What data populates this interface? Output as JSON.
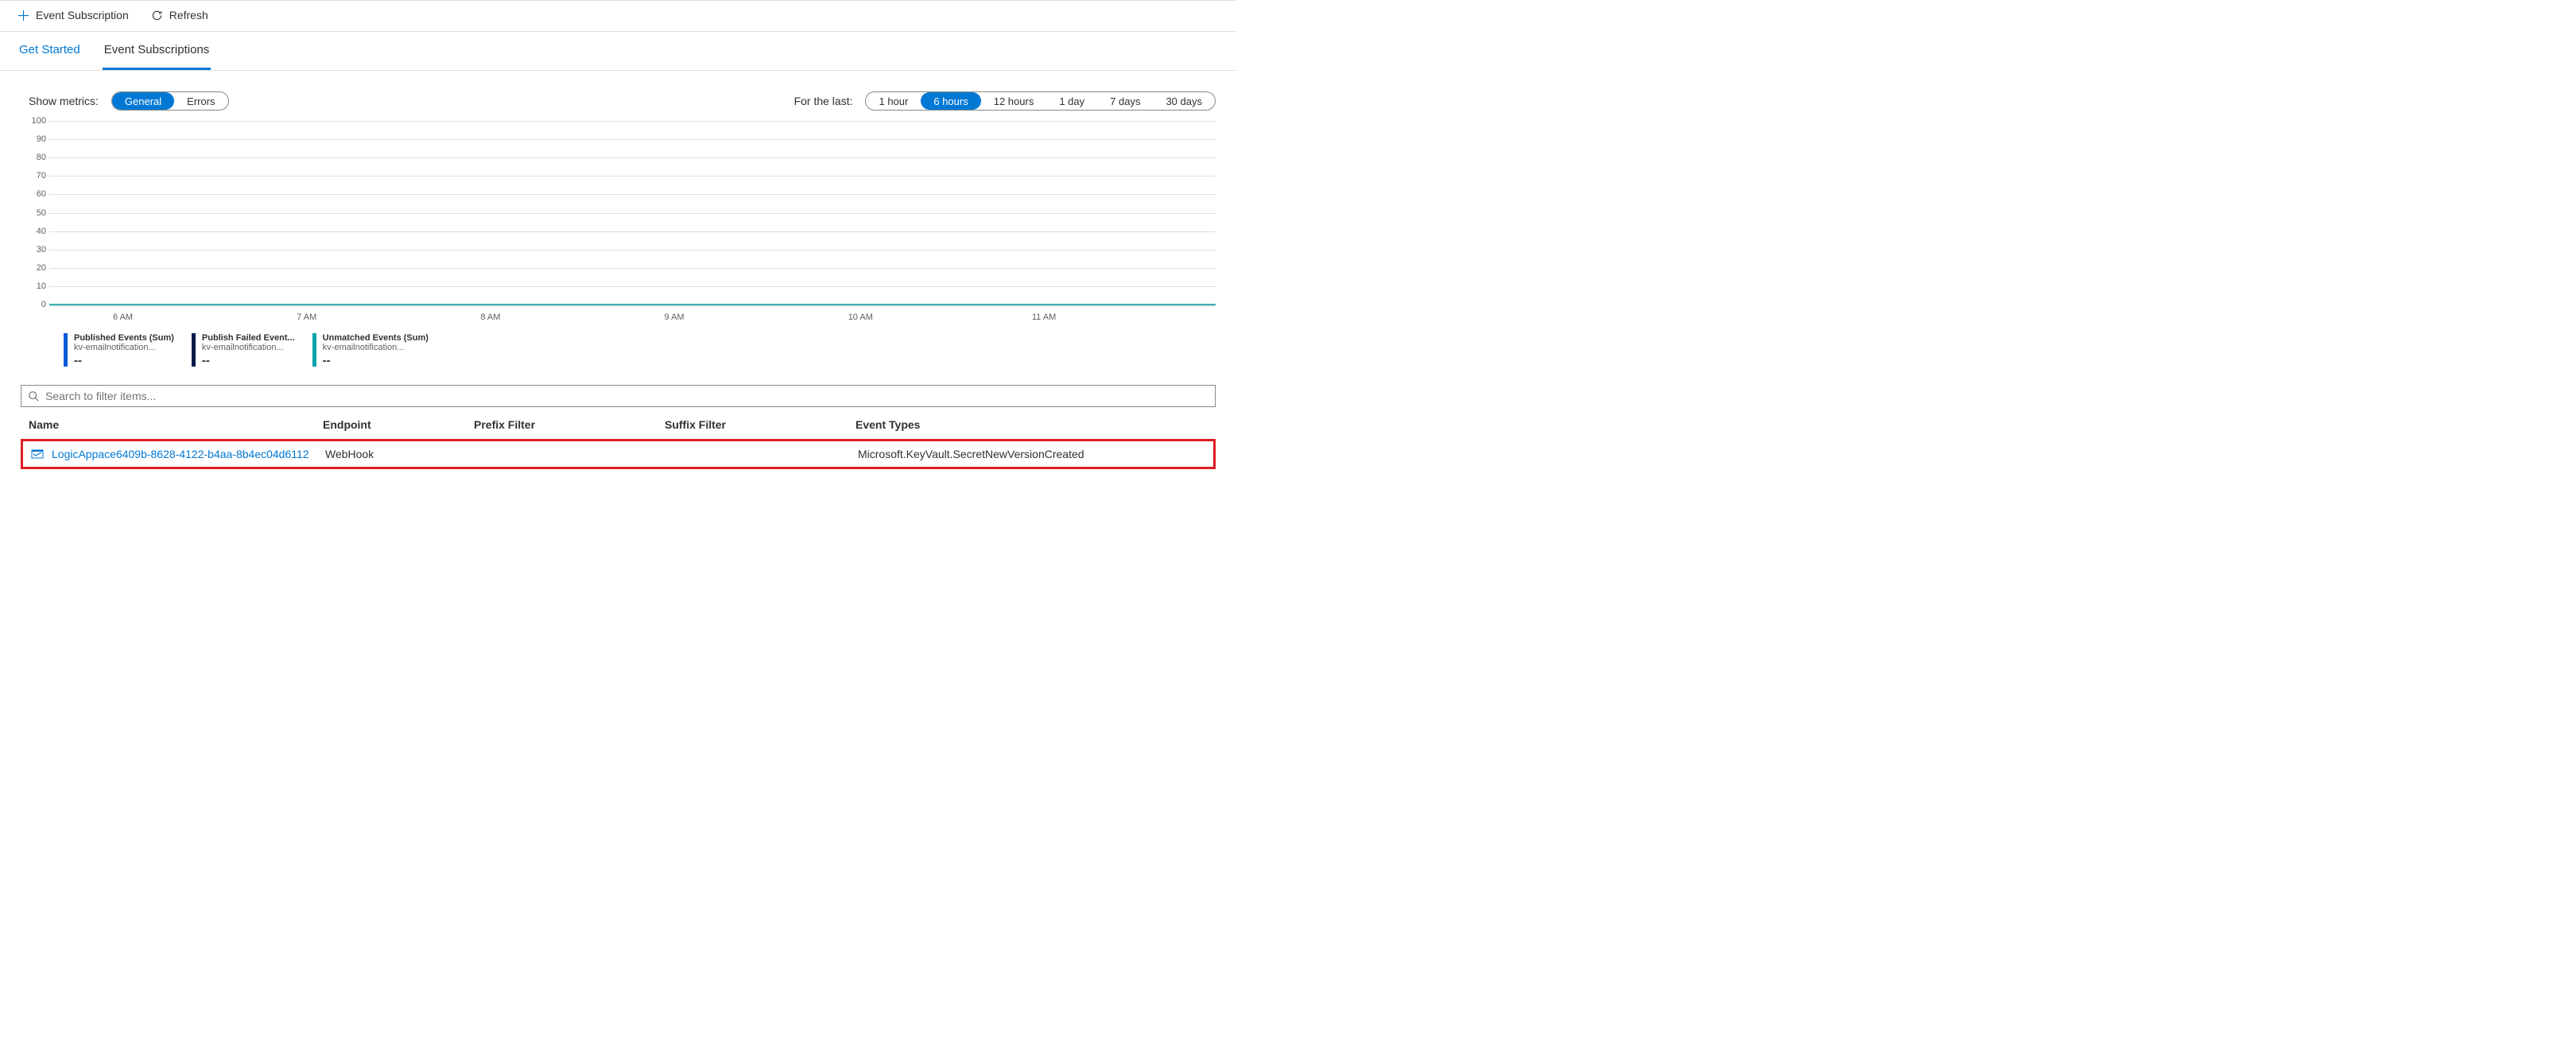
{
  "toolbar": {
    "add_label": "Event Subscription",
    "refresh_label": "Refresh"
  },
  "tabs": {
    "get_started": "Get Started",
    "event_subscriptions": "Event Subscriptions",
    "active": "event_subscriptions"
  },
  "controls": {
    "metrics_label": "Show metrics:",
    "metrics_options": [
      "General",
      "Errors"
    ],
    "metrics_selected": "General",
    "range_label": "For the last:",
    "range_options": [
      "1 hour",
      "6 hours",
      "12 hours",
      "1 day",
      "7 days",
      "30 days"
    ],
    "range_selected": "6 hours"
  },
  "chart_data": {
    "type": "line",
    "title": "",
    "xlabel": "",
    "ylabel": "",
    "ylim": [
      0,
      100
    ],
    "y_ticks": [
      0,
      10,
      20,
      30,
      40,
      50,
      60,
      70,
      80,
      90,
      100
    ],
    "x_ticks": [
      "6 AM",
      "7 AM",
      "8 AM",
      "9 AM",
      "10 AM",
      "11 AM"
    ],
    "series": [
      {
        "name": "Published Events (Sum)",
        "sub": "kv-emailnotification...",
        "value": "--",
        "color": "#015cda",
        "y_constant": 0
      },
      {
        "name": "Publish Failed Event...",
        "sub": "kv-emailnotification...",
        "value": "--",
        "color": "#021b47",
        "y_constant": 0
      },
      {
        "name": "Unmatched Events (Sum)",
        "sub": "kv-emailnotification...",
        "value": "--",
        "color": "#05a4ac",
        "y_constant": 0
      }
    ]
  },
  "filter": {
    "placeholder": "Search to filter items..."
  },
  "columns": {
    "name": "Name",
    "endpoint": "Endpoint",
    "prefix": "Prefix Filter",
    "suffix": "Suffix Filter",
    "event_types": "Event Types"
  },
  "rows": [
    {
      "name": "LogicAppace6409b-8628-4122-b4aa-8b4ec04d6112",
      "endpoint": "WebHook",
      "prefix": "",
      "suffix": "",
      "event_types": "Microsoft.KeyVault.SecretNewVersionCreated"
    }
  ]
}
